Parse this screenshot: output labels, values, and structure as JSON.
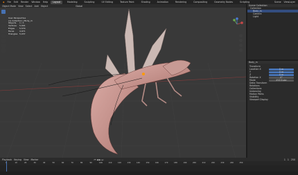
{
  "menu": [
    "File",
    "Edit",
    "Render",
    "Window",
    "Help"
  ],
  "workspaces": [
    "Layout",
    "Modeling",
    "Sculpting",
    "UV Editing",
    "Texture Paint",
    "Shading",
    "Animation",
    "Rendering",
    "Compositing",
    "Geometry Nodes",
    "Scripting"
  ],
  "scene": "Scene",
  "view_layer": "ViewLayer",
  "viewport": {
    "mode": "Object Mode",
    "menus": [
      "View",
      "Select",
      "Add",
      "Object"
    ],
    "global": "Global",
    "title": "User Perspective",
    "collection": "(1) Collection | Body_m",
    "stats": [
      {
        "label": "Objects",
        "value": "1 / 1"
      },
      {
        "label": "Vertices",
        "value": "5,091"
      },
      {
        "label": "Edges",
        "value": "5,579"
      },
      {
        "label": "Faces",
        "value": "4,971"
      },
      {
        "label": "Triangles",
        "value": "5,037"
      }
    ]
  },
  "outliner": {
    "title": "Scene Collection",
    "items": [
      "Collection",
      "Body_m",
      "Camera",
      "Light"
    ]
  },
  "properties": {
    "object": "Body_m",
    "tabs": [
      "Transform",
      "Delta Transform",
      "Relations",
      "Collections",
      "Instancing",
      "Motion Paths",
      "Visibility",
      "Viewport Display"
    ],
    "fields": [
      {
        "label": "Location X",
        "value": "0 m"
      },
      {
        "label": "Y",
        "value": "0 m"
      },
      {
        "label": "Z",
        "value": "0 m"
      },
      {
        "label": "Rotation X",
        "value": "0°"
      },
      {
        "label": "Mode",
        "value": "XYZ Euler"
      }
    ]
  },
  "timeline": {
    "menus": [
      "Playback",
      "Keying",
      "View",
      "Marker"
    ],
    "frame": "1",
    "start": "1",
    "end": "250",
    "ticks": [
      "0",
      "10",
      "20",
      "30",
      "40",
      "50",
      "60",
      "70",
      "80",
      "90",
      "100",
      "110",
      "120",
      "130",
      "140",
      "150",
      "160",
      "170",
      "180",
      "190",
      "200",
      "210",
      "220",
      "230",
      "240",
      "250"
    ]
  }
}
